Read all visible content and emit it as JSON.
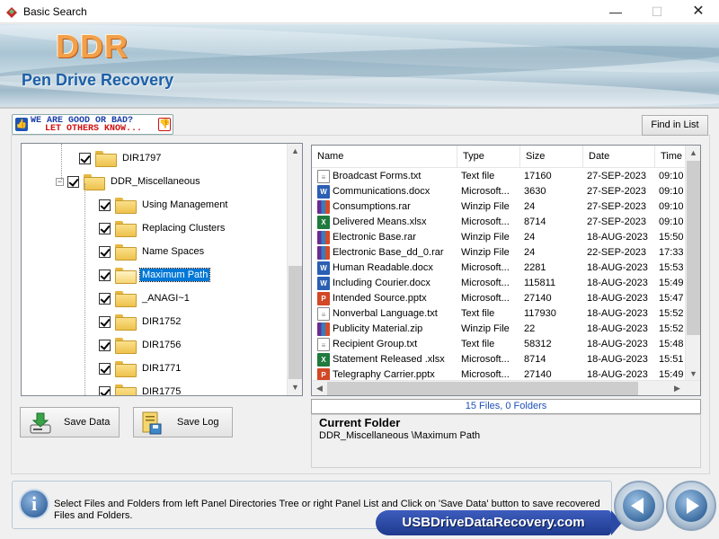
{
  "window": {
    "title": "Basic Search",
    "min": "—",
    "max": "☐",
    "close": "✕"
  },
  "banner": {
    "logo": "DDR",
    "product": "Pen Drive Recovery"
  },
  "feedback": {
    "line1": "WE ARE GOOD OR BAD?",
    "line2": "LET OTHERS KNOW..."
  },
  "toolbar": {
    "find_label": "Find in List"
  },
  "tree": {
    "items": [
      {
        "label": "DIR1797",
        "selected": false
      },
      {
        "label": "DDR_Miscellaneous",
        "selected": false,
        "expander": "−"
      },
      {
        "label": "Using Management",
        "selected": false
      },
      {
        "label": "Replacing Clusters",
        "selected": false
      },
      {
        "label": "Name Spaces",
        "selected": false
      },
      {
        "label": "Maximum Path",
        "selected": true
      },
      {
        "label": "_ANAGI~1",
        "selected": false
      },
      {
        "label": "DIR1752",
        "selected": false
      },
      {
        "label": "DIR1756",
        "selected": false
      },
      {
        "label": "DIR1771",
        "selected": false
      },
      {
        "label": "DIR1775",
        "selected": false
      }
    ]
  },
  "list": {
    "columns": [
      "Name",
      "Type",
      "Size",
      "Date",
      "Time"
    ],
    "rows": [
      {
        "icon": "txt",
        "name": "Broadcast Forms.txt",
        "type": "Text file",
        "size": "17160",
        "date": "27-SEP-2023",
        "time": "09:10"
      },
      {
        "icon": "docx",
        "name": "Communications.docx",
        "type": "Microsoft...",
        "size": "3630",
        "date": "27-SEP-2023",
        "time": "09:10"
      },
      {
        "icon": "rar",
        "name": "Consumptions.rar",
        "type": "Winzip File",
        "size": "24",
        "date": "27-SEP-2023",
        "time": "09:10"
      },
      {
        "icon": "xlsx",
        "name": "Delivered Means.xlsx",
        "type": "Microsoft...",
        "size": "8714",
        "date": "27-SEP-2023",
        "time": "09:10"
      },
      {
        "icon": "rar",
        "name": "Electronic Base.rar",
        "type": "Winzip File",
        "size": "24",
        "date": "18-AUG-2023",
        "time": "15:50"
      },
      {
        "icon": "rar",
        "name": "Electronic Base_dd_0.rar",
        "type": "Winzip File",
        "size": "24",
        "date": "22-SEP-2023",
        "time": "17:33"
      },
      {
        "icon": "docx",
        "name": "Human Readable.docx",
        "type": "Microsoft...",
        "size": "2281",
        "date": "18-AUG-2023",
        "time": "15:53"
      },
      {
        "icon": "docx",
        "name": "Including Courier.docx",
        "type": "Microsoft...",
        "size": "115811",
        "date": "18-AUG-2023",
        "time": "15:49"
      },
      {
        "icon": "pptx",
        "name": "Intended Source.pptx",
        "type": "Microsoft...",
        "size": "27140",
        "date": "18-AUG-2023",
        "time": "15:47"
      },
      {
        "icon": "txt",
        "name": "Nonverbal Language.txt",
        "type": "Text file",
        "size": "117930",
        "date": "18-AUG-2023",
        "time": "15:52"
      },
      {
        "icon": "rar",
        "name": "Publicity Material.zip",
        "type": "Winzip File",
        "size": "22",
        "date": "18-AUG-2023",
        "time": "15:52"
      },
      {
        "icon": "txt",
        "name": "Recipient Group.txt",
        "type": "Text file",
        "size": "58312",
        "date": "18-AUG-2023",
        "time": "15:48"
      },
      {
        "icon": "xlsx",
        "name": "Statement Released .xlsx",
        "type": "Microsoft...",
        "size": "8714",
        "date": "18-AUG-2023",
        "time": "15:51"
      },
      {
        "icon": "pptx",
        "name": "Telegraphy Carrier.pptx",
        "type": "Microsoft...",
        "size": "27140",
        "date": "18-AUG-2023",
        "time": "15:49"
      }
    ]
  },
  "status": {
    "summary": "15 Files, 0 Folders"
  },
  "current_folder": {
    "title": "Current Folder",
    "path": "DDR_Miscellaneous \\Maximum Path"
  },
  "buttons": {
    "save_data": "Save Data",
    "save_log": "Save Log"
  },
  "info": {
    "text": "Select Files and Folders from left Panel Directories Tree or right Panel List and Click on 'Save Data' button to save recovered Files and Folders."
  },
  "brand": {
    "site": "USBDriveDataRecovery.com"
  },
  "icons": {
    "info": "i",
    "thumb_up": "👍",
    "thumb_down": "👎"
  }
}
